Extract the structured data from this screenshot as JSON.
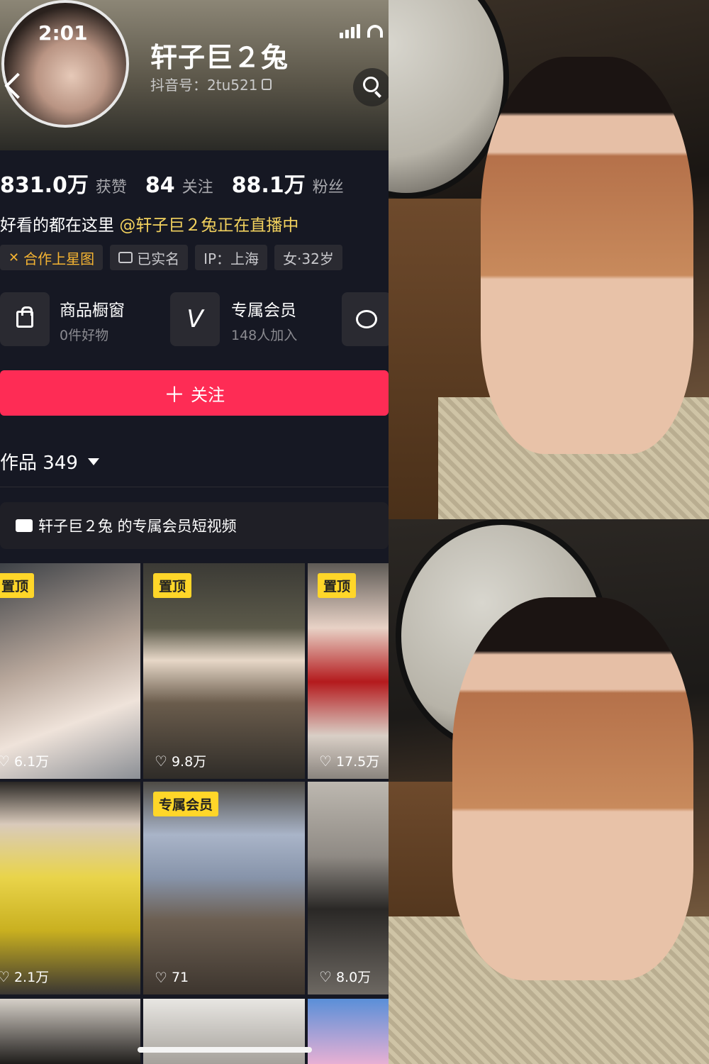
{
  "status_bar": {
    "time": "2:01"
  },
  "profile": {
    "name": "轩子巨２兔",
    "douyin_id": "抖音号：2tu521"
  },
  "stats": [
    {
      "value": "831.0万",
      "label": "获赞"
    },
    {
      "value": "84",
      "label": "关注"
    },
    {
      "value": "88.1万",
      "label": "粉丝"
    }
  ],
  "bio": {
    "text": "好看的都在这里",
    "mention": "@轩子巨２兔正在直播中"
  },
  "tags": [
    {
      "label": "合作上星图",
      "icon": "star-icon"
    },
    {
      "label": "已实名",
      "icon": "id-card-icon"
    },
    {
      "label": "IP：上海",
      "icon": ""
    },
    {
      "label": "女·32岁",
      "icon": ""
    }
  ],
  "features": {
    "shop": {
      "title": "商品橱窗",
      "subtitle": "0件好物",
      "icon": "shopping-bag-icon"
    },
    "membership": {
      "title": "专属会员",
      "subtitle": "148人加入",
      "icon": "v-icon"
    },
    "chat": {
      "icon": "chat-icon"
    }
  },
  "follow_button": {
    "label": "关注",
    "icon": "plus-icon"
  },
  "works_tab": {
    "label": "作品 349"
  },
  "member_bar": {
    "label": "轩子巨２兔 的专属会员短视频"
  },
  "videos": [
    {
      "badge": "置顶",
      "likes": "6.1万"
    },
    {
      "badge": "置顶",
      "likes": "9.8万"
    },
    {
      "badge": "置顶",
      "likes": "17.5万"
    },
    {
      "badge": "",
      "likes": "2.1万"
    },
    {
      "badge": "专属会员",
      "likes": "71"
    },
    {
      "badge": "",
      "likes": "8.0万"
    }
  ],
  "colors": {
    "follow": "#fe2c55",
    "badge": "#ffd629",
    "mention": "#f3d25e",
    "star": "#f5b432"
  }
}
